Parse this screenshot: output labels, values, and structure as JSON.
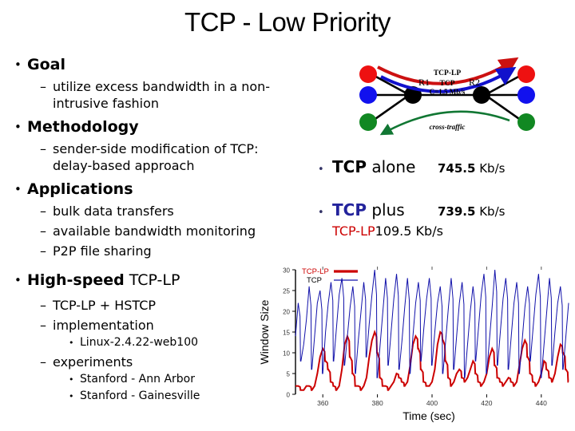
{
  "slide": {
    "title": "TCP - Low Priority"
  },
  "outline": [
    {
      "level": 1,
      "bullet": "•",
      "bold_text": "Goal",
      "regular_text": ""
    },
    {
      "level": 2,
      "bullet": "–",
      "text": "utilize excess bandwidth in a non-intrusive fashion"
    },
    {
      "level": 1,
      "bullet": "•",
      "bold_text": "Methodology",
      "regular_text": ""
    },
    {
      "level": 2,
      "bullet": "–",
      "text": "sender-side modification of TCP: delay-based approach"
    },
    {
      "level": 1,
      "bullet": "•",
      "bold_text": "Applications",
      "regular_text": ""
    },
    {
      "level": 2,
      "bullet": "–",
      "text": "bulk data transfers"
    },
    {
      "level": 2,
      "bullet": "–",
      "text": "available bandwidth monitoring"
    },
    {
      "level": 2,
      "bullet": "–",
      "text": "P2P file sharing"
    },
    {
      "level": 1,
      "bullet": "•",
      "bold_text": "High-speed",
      "regular_text": " TCP-LP"
    },
    {
      "level": 2,
      "bullet": "–",
      "text": "TCP-LP + HSTCP"
    },
    {
      "level": 2,
      "bullet": "–",
      "text": "implementation"
    },
    {
      "level": 3,
      "bullet": "•",
      "text": "Linux-2.4.22-web100"
    },
    {
      "level": 2,
      "bullet": "–",
      "text": "experiments"
    },
    {
      "level": 3,
      "bullet": "•",
      "text": "Stanford - Ann Arbor"
    },
    {
      "level": 3,
      "bullet": "•",
      "text": "Stanford - Gainesville"
    }
  ],
  "diagram": {
    "router_left": "R1",
    "router_right": "R2",
    "arrow_tcplp_label": "TCP-LP",
    "arrow_tcp_label": "TCP",
    "link_capacity_label": "C=1.5 Mb/s",
    "cross_traffic_label": "cross-traffic",
    "colors": {
      "tcplp_arrow": "#cc1111",
      "tcp_arrow": "#1111cc",
      "cross_traffic_arrow": "#117733",
      "host_red": "#ee1111",
      "host_blue": "#1111ee",
      "host_green": "#118822",
      "router": "#000000"
    }
  },
  "results": {
    "row1": {
      "bullet": "•",
      "label_bold": "TCP",
      "label_regular": " alone",
      "value_number": "745.5",
      "value_unit": " Kb/s"
    },
    "row2": {
      "bullet": "•",
      "label_bold": "TCP",
      "label_regular": " plus",
      "value_number": "739.5",
      "value_unit": " Kb/s"
    },
    "row2_sub": {
      "label_bold": "TCP-LP",
      "value_number": "109.5",
      "value_unit": " Kb/s"
    },
    "colors": {
      "tcp_blue": "#23239c",
      "tcplp_red": "#cc0000"
    }
  },
  "chart_data": {
    "type": "line",
    "title": "",
    "xlabel": "Time (sec)",
    "ylabel": "Window Size",
    "xlim": [
      350,
      450
    ],
    "ylim": [
      0,
      30
    ],
    "xticks": [
      360,
      380,
      400,
      420,
      440
    ],
    "yticks": [
      0,
      5,
      10,
      15,
      20,
      25,
      30
    ],
    "grid": false,
    "legend_position": "top-left",
    "series": [
      {
        "name": "TCP-LP",
        "color": "#cc0000",
        "linewidth": 2,
        "x": [
          350,
          351,
          352,
          353,
          354,
          355,
          356,
          357,
          358,
          359,
          360,
          361,
          362,
          363,
          364,
          365,
          366,
          367,
          368,
          369,
          370,
          371,
          372,
          373,
          374,
          375,
          376,
          377,
          378,
          379,
          380,
          381,
          382,
          383,
          384,
          385,
          386,
          387,
          388,
          389,
          390,
          391,
          392,
          393,
          394,
          395,
          396,
          397,
          398,
          399,
          400,
          401,
          402,
          403,
          404,
          405,
          406,
          407,
          408,
          409,
          410,
          411,
          412,
          413,
          414,
          415,
          416,
          417,
          418,
          419,
          420,
          421,
          422,
          423,
          424,
          425,
          426,
          427,
          428,
          429,
          430,
          431,
          432,
          433,
          434,
          435,
          436,
          437,
          438,
          439,
          440,
          441,
          442,
          443,
          444,
          445,
          446,
          447,
          448,
          449,
          450
        ],
        "y": [
          2,
          2,
          1,
          1,
          2,
          2,
          1,
          2,
          5,
          9,
          11,
          8,
          6,
          3,
          2,
          1,
          2,
          6,
          12,
          14,
          9,
          5,
          2,
          2,
          1,
          2,
          4,
          9,
          13,
          15,
          10,
          4,
          2,
          2,
          1,
          2,
          3,
          5,
          4,
          3,
          2,
          3,
          7,
          12,
          14,
          11,
          6,
          3,
          2,
          2,
          3,
          6,
          12,
          15,
          13,
          8,
          4,
          2,
          3,
          5,
          6,
          4,
          3,
          4,
          6,
          8,
          5,
          3,
          2,
          3,
          5,
          9,
          11,
          7,
          4,
          3,
          2,
          3,
          4,
          3,
          2,
          3,
          7,
          11,
          13,
          9,
          5,
          3,
          2,
          3,
          5,
          8,
          6,
          4,
          3,
          5,
          9,
          12,
          10,
          6,
          3
        ]
      },
      {
        "name": "TCP",
        "color": "#1111aa",
        "linewidth": 1,
        "x": [
          350,
          351,
          352,
          353,
          354,
          355,
          356,
          357,
          358,
          359,
          360,
          361,
          362,
          363,
          364,
          365,
          366,
          367,
          368,
          369,
          370,
          371,
          372,
          373,
          374,
          375,
          376,
          377,
          378,
          379,
          380,
          381,
          382,
          383,
          384,
          385,
          386,
          387,
          388,
          389,
          390,
          391,
          392,
          393,
          394,
          395,
          396,
          397,
          398,
          399,
          400,
          401,
          402,
          403,
          404,
          405,
          406,
          407,
          408,
          409,
          410,
          411,
          412,
          413,
          414,
          415,
          416,
          417,
          418,
          419,
          420,
          421,
          422,
          423,
          424,
          425,
          426,
          427,
          428,
          429,
          430,
          431,
          432,
          433,
          434,
          435,
          436,
          437,
          438,
          439,
          440,
          441,
          442,
          443,
          444,
          445,
          446,
          447,
          448,
          449,
          450
        ],
        "y": [
          14,
          22,
          8,
          12,
          18,
          26,
          6,
          14,
          22,
          25,
          5,
          15,
          22,
          27,
          8,
          16,
          24,
          28,
          7,
          14,
          21,
          26,
          5,
          13,
          20,
          27,
          9,
          17,
          24,
          30,
          4,
          12,
          20,
          28,
          7,
          15,
          23,
          29,
          6,
          13,
          21,
          28,
          5,
          14,
          22,
          27,
          8,
          16,
          23,
          28,
          7,
          15,
          22,
          26,
          5,
          13,
          21,
          28,
          6,
          14,
          22,
          27,
          4,
          12,
          20,
          26,
          8,
          16,
          24,
          29,
          5,
          13,
          21,
          30,
          7,
          15,
          23,
          28,
          6,
          14,
          22,
          27,
          5,
          13,
          21,
          26,
          8,
          16,
          24,
          29,
          4,
          12,
          20,
          28,
          7,
          15,
          22,
          26,
          6,
          14,
          22
        ]
      }
    ]
  }
}
